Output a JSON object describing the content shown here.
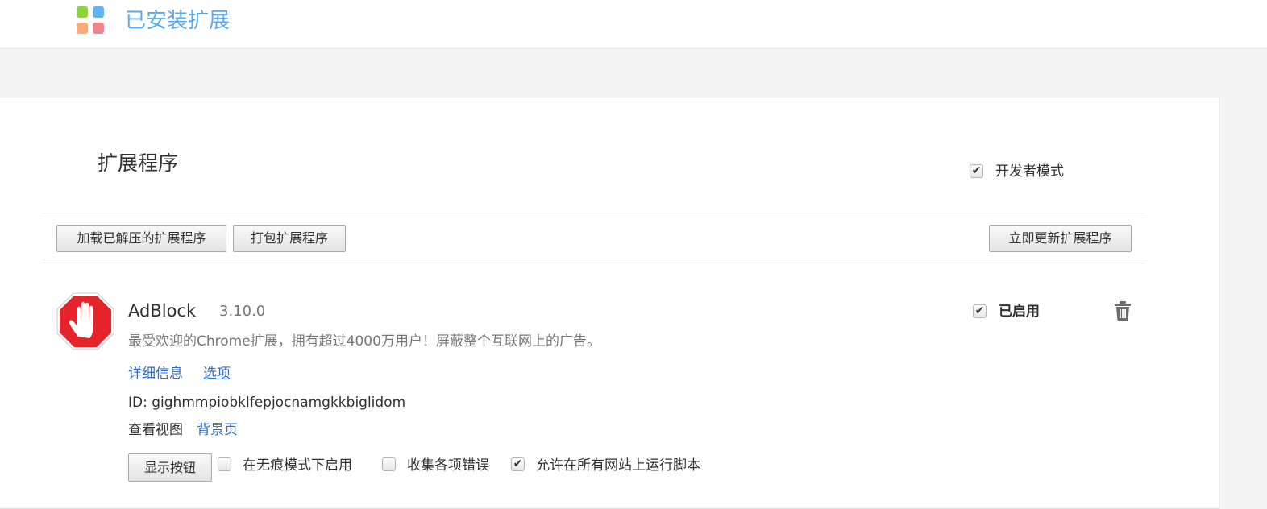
{
  "header": {
    "app_title": "已安装扩展",
    "logo_icon": "extensions-grid-icon",
    "logo_colors": [
      "#8bd53b",
      "#5cb6f7",
      "#ffaa78",
      "#f5838f"
    ]
  },
  "page": {
    "section_title": "扩展程序",
    "developer_mode": {
      "label": "开发者模式",
      "checked": true,
      "check_glyph": "✔"
    }
  },
  "toolbar": {
    "load_unpacked_label": "加载已解压的扩展程序",
    "pack_label": "打包扩展程序",
    "update_now_label": "立即更新扩展程序"
  },
  "extension": {
    "name": "AdBlock",
    "version": "3.10.0",
    "description": "最受欢迎的Chrome扩展，拥有超过4000万用户！屏蔽整个互联网上的广告。",
    "details_link": "详细信息",
    "options_link": "选项",
    "id_text": "ID: gighmmpiobklfepjocnamgkkbiglidom",
    "inspect_views_label": "查看视图",
    "background_page_link": "背景页",
    "show_button_label": "显示按钮",
    "incognito": {
      "label": "在无痕模式下启用",
      "checked": false,
      "check_glyph": ""
    },
    "collect_errors": {
      "label": "收集各项错误",
      "checked": false,
      "check_glyph": ""
    },
    "all_urls": {
      "label": "允许在所有网站上运行脚本",
      "checked": true,
      "check_glyph": "✔"
    },
    "enabled": {
      "label": "已启用",
      "checked": true,
      "check_glyph": "✔"
    },
    "remove_icon": "trash-icon",
    "icon": "adblock-stop-hand-icon",
    "icon_color": "#e4232a"
  }
}
